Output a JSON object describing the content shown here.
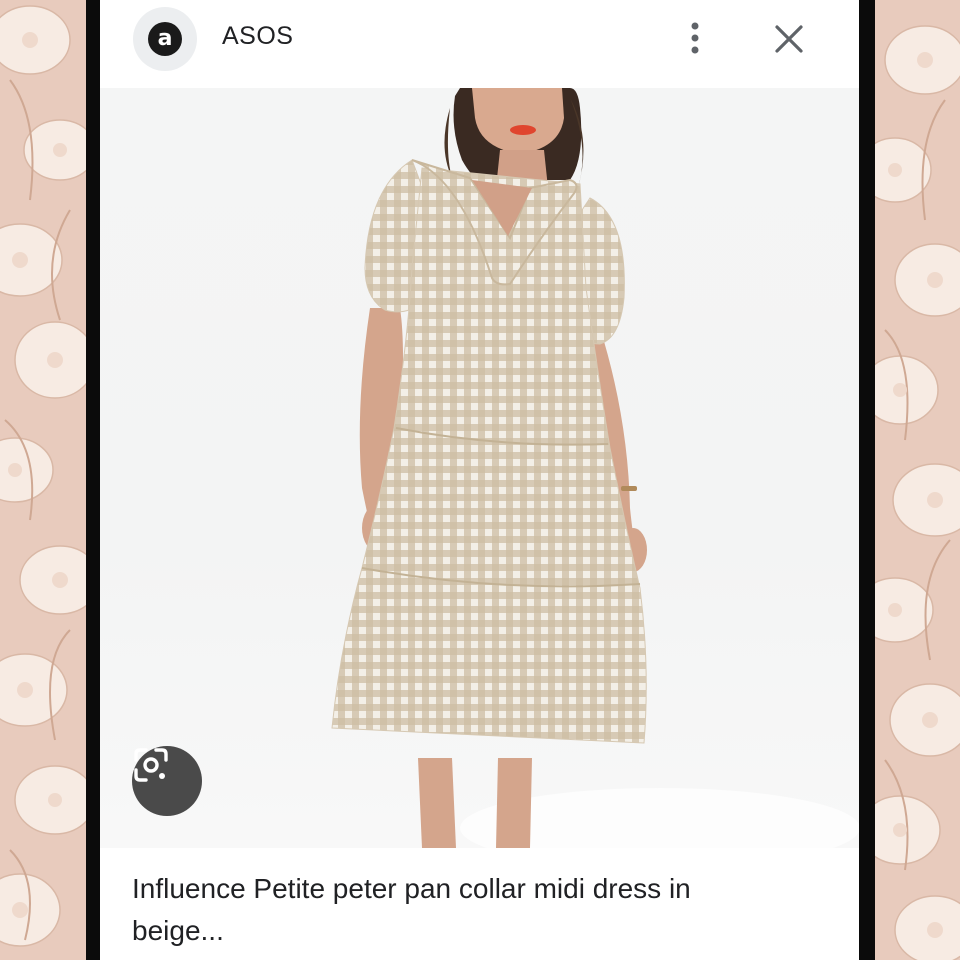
{
  "header": {
    "logo_letter": "a",
    "site_name": "ASOS"
  },
  "icons": {
    "logo": "asos-logo-icon",
    "more": "more-vert-icon",
    "close": "close-icon",
    "lens": "google-lens-icon"
  },
  "product": {
    "title": "Influence Petite peter pan collar midi dress in beige..."
  },
  "colors": {
    "background_floral": "#e8cbbd",
    "dress_gingham": "#cdbda4",
    "lens_button": "#4a4a4a"
  }
}
